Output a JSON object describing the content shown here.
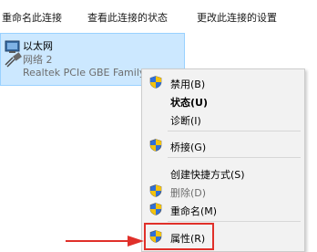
{
  "toolbar": {
    "items": [
      {
        "label": "重命名此连接"
      },
      {
        "label": "查看此连接的状态"
      },
      {
        "label": "更改此连接的设置"
      }
    ]
  },
  "adapter": {
    "name": "以太网",
    "status": "网络 2",
    "device": "Realtek PCIe GBE Family Controller"
  },
  "context_menu": {
    "items": [
      {
        "label": "禁用(B)",
        "icon": "uac-shield-icon",
        "bold": false,
        "disabled": false
      },
      {
        "label": "状态(U)",
        "icon": "",
        "bold": true,
        "disabled": false
      },
      {
        "label": "诊断(I)",
        "icon": "",
        "bold": false,
        "disabled": false
      },
      {
        "label": "桥接(G)",
        "icon": "uac-shield-icon",
        "bold": false,
        "disabled": false
      },
      {
        "label": "创建快捷方式(S)",
        "icon": "",
        "bold": false,
        "disabled": false
      },
      {
        "label": "删除(D)",
        "icon": "uac-shield-icon",
        "bold": false,
        "disabled": true
      },
      {
        "label": "重命名(M)",
        "icon": "uac-shield-icon",
        "bold": false,
        "disabled": false
      },
      {
        "label": "属性(R)",
        "icon": "uac-shield-icon",
        "bold": false,
        "disabled": false
      }
    ]
  },
  "annotation": {
    "highlight_color": "#e0302a",
    "arrow_color": "#e0302a"
  }
}
